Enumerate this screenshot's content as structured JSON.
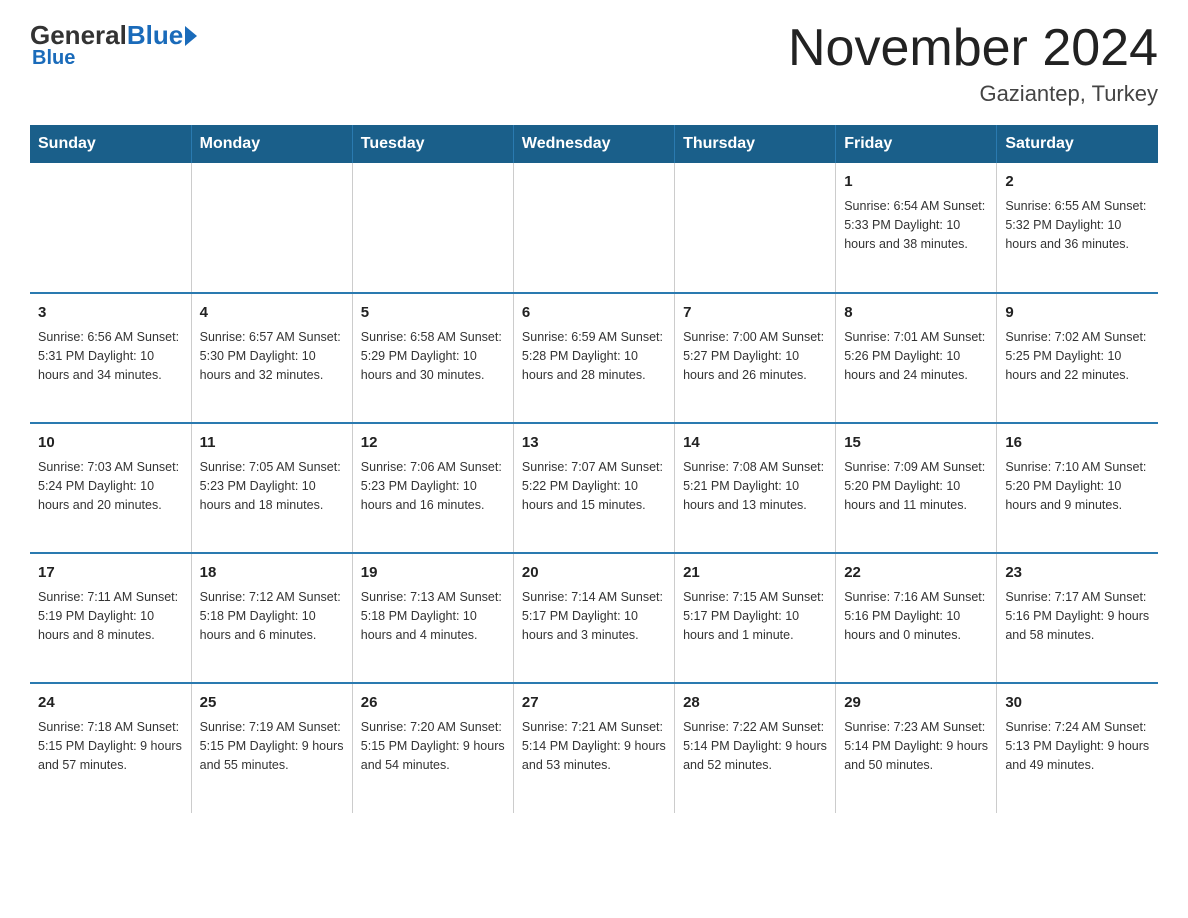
{
  "logo": {
    "text_general": "General",
    "text_blue": "Blue",
    "sub": "Blue"
  },
  "header": {
    "title": "November 2024",
    "subtitle": "Gaziantep, Turkey"
  },
  "days_of_week": [
    "Sunday",
    "Monday",
    "Tuesday",
    "Wednesday",
    "Thursday",
    "Friday",
    "Saturday"
  ],
  "weeks": [
    [
      {
        "num": "",
        "info": ""
      },
      {
        "num": "",
        "info": ""
      },
      {
        "num": "",
        "info": ""
      },
      {
        "num": "",
        "info": ""
      },
      {
        "num": "",
        "info": ""
      },
      {
        "num": "1",
        "info": "Sunrise: 6:54 AM\nSunset: 5:33 PM\nDaylight: 10 hours and 38 minutes."
      },
      {
        "num": "2",
        "info": "Sunrise: 6:55 AM\nSunset: 5:32 PM\nDaylight: 10 hours and 36 minutes."
      }
    ],
    [
      {
        "num": "3",
        "info": "Sunrise: 6:56 AM\nSunset: 5:31 PM\nDaylight: 10 hours and 34 minutes."
      },
      {
        "num": "4",
        "info": "Sunrise: 6:57 AM\nSunset: 5:30 PM\nDaylight: 10 hours and 32 minutes."
      },
      {
        "num": "5",
        "info": "Sunrise: 6:58 AM\nSunset: 5:29 PM\nDaylight: 10 hours and 30 minutes."
      },
      {
        "num": "6",
        "info": "Sunrise: 6:59 AM\nSunset: 5:28 PM\nDaylight: 10 hours and 28 minutes."
      },
      {
        "num": "7",
        "info": "Sunrise: 7:00 AM\nSunset: 5:27 PM\nDaylight: 10 hours and 26 minutes."
      },
      {
        "num": "8",
        "info": "Sunrise: 7:01 AM\nSunset: 5:26 PM\nDaylight: 10 hours and 24 minutes."
      },
      {
        "num": "9",
        "info": "Sunrise: 7:02 AM\nSunset: 5:25 PM\nDaylight: 10 hours and 22 minutes."
      }
    ],
    [
      {
        "num": "10",
        "info": "Sunrise: 7:03 AM\nSunset: 5:24 PM\nDaylight: 10 hours and 20 minutes."
      },
      {
        "num": "11",
        "info": "Sunrise: 7:05 AM\nSunset: 5:23 PM\nDaylight: 10 hours and 18 minutes."
      },
      {
        "num": "12",
        "info": "Sunrise: 7:06 AM\nSunset: 5:23 PM\nDaylight: 10 hours and 16 minutes."
      },
      {
        "num": "13",
        "info": "Sunrise: 7:07 AM\nSunset: 5:22 PM\nDaylight: 10 hours and 15 minutes."
      },
      {
        "num": "14",
        "info": "Sunrise: 7:08 AM\nSunset: 5:21 PM\nDaylight: 10 hours and 13 minutes."
      },
      {
        "num": "15",
        "info": "Sunrise: 7:09 AM\nSunset: 5:20 PM\nDaylight: 10 hours and 11 minutes."
      },
      {
        "num": "16",
        "info": "Sunrise: 7:10 AM\nSunset: 5:20 PM\nDaylight: 10 hours and 9 minutes."
      }
    ],
    [
      {
        "num": "17",
        "info": "Sunrise: 7:11 AM\nSunset: 5:19 PM\nDaylight: 10 hours and 8 minutes."
      },
      {
        "num": "18",
        "info": "Sunrise: 7:12 AM\nSunset: 5:18 PM\nDaylight: 10 hours and 6 minutes."
      },
      {
        "num": "19",
        "info": "Sunrise: 7:13 AM\nSunset: 5:18 PM\nDaylight: 10 hours and 4 minutes."
      },
      {
        "num": "20",
        "info": "Sunrise: 7:14 AM\nSunset: 5:17 PM\nDaylight: 10 hours and 3 minutes."
      },
      {
        "num": "21",
        "info": "Sunrise: 7:15 AM\nSunset: 5:17 PM\nDaylight: 10 hours and 1 minute."
      },
      {
        "num": "22",
        "info": "Sunrise: 7:16 AM\nSunset: 5:16 PM\nDaylight: 10 hours and 0 minutes."
      },
      {
        "num": "23",
        "info": "Sunrise: 7:17 AM\nSunset: 5:16 PM\nDaylight: 9 hours and 58 minutes."
      }
    ],
    [
      {
        "num": "24",
        "info": "Sunrise: 7:18 AM\nSunset: 5:15 PM\nDaylight: 9 hours and 57 minutes."
      },
      {
        "num": "25",
        "info": "Sunrise: 7:19 AM\nSunset: 5:15 PM\nDaylight: 9 hours and 55 minutes."
      },
      {
        "num": "26",
        "info": "Sunrise: 7:20 AM\nSunset: 5:15 PM\nDaylight: 9 hours and 54 minutes."
      },
      {
        "num": "27",
        "info": "Sunrise: 7:21 AM\nSunset: 5:14 PM\nDaylight: 9 hours and 53 minutes."
      },
      {
        "num": "28",
        "info": "Sunrise: 7:22 AM\nSunset: 5:14 PM\nDaylight: 9 hours and 52 minutes."
      },
      {
        "num": "29",
        "info": "Sunrise: 7:23 AM\nSunset: 5:14 PM\nDaylight: 9 hours and 50 minutes."
      },
      {
        "num": "30",
        "info": "Sunrise: 7:24 AM\nSunset: 5:13 PM\nDaylight: 9 hours and 49 minutes."
      }
    ]
  ]
}
